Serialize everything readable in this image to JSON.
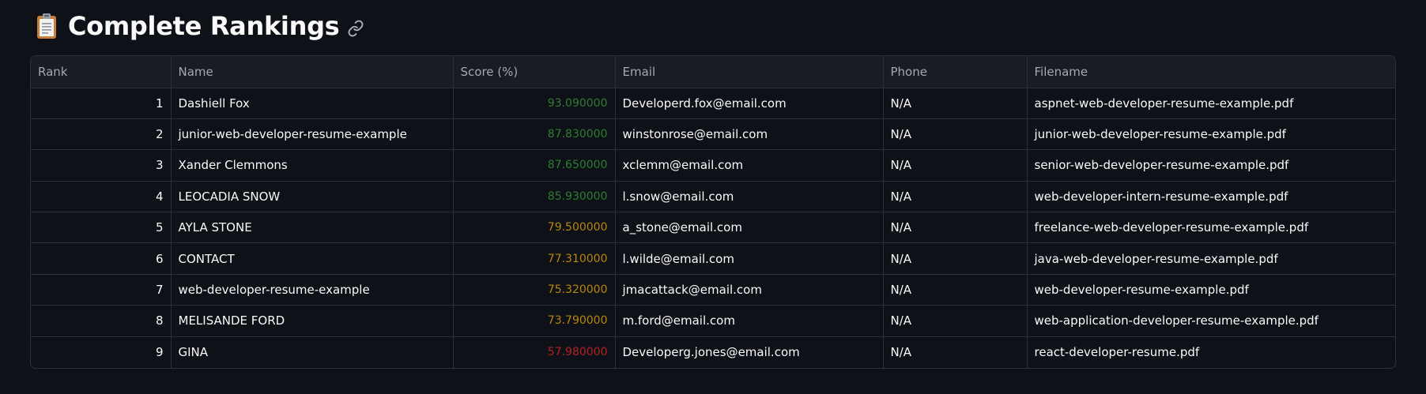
{
  "header": {
    "title": "Complete Rankings",
    "icon": "clipboard-icon",
    "link_icon": "link-icon"
  },
  "table": {
    "columns": [
      "Rank",
      "Name",
      "Score (%)",
      "Email",
      "Phone",
      "Filename"
    ],
    "rows": [
      {
        "rank": "1",
        "name": "Dashiell Fox",
        "score": "93.090000",
        "score_color": "#2e7d32",
        "email": "Developerd.fox@email.com",
        "phone": "N/A",
        "filename": "aspnet-web-developer-resume-example.pdf"
      },
      {
        "rank": "2",
        "name": "junior-web-developer-resume-example",
        "score": "87.830000",
        "score_color": "#2e7d32",
        "email": "winstonrose@email.com",
        "phone": "N/A",
        "filename": "junior-web-developer-resume-example.pdf"
      },
      {
        "rank": "3",
        "name": "Xander Clemmons",
        "score": "87.650000",
        "score_color": "#2e7d32",
        "email": "xclemm@email.com",
        "phone": "N/A",
        "filename": "senior-web-developer-resume-example.pdf"
      },
      {
        "rank": "4",
        "name": "LEOCADIA SNOW",
        "score": "85.930000",
        "score_color": "#2e7d32",
        "email": "l.snow@email.com",
        "phone": "N/A",
        "filename": "web-developer-intern-resume-example.pdf"
      },
      {
        "rank": "5",
        "name": "AYLA STONE",
        "score": "79.500000",
        "score_color": "#b8860b",
        "email": "a_stone@email.com",
        "phone": "N/A",
        "filename": "freelance-web-developer-resume-example.pdf"
      },
      {
        "rank": "6",
        "name": "CONTACT",
        "score": "77.310000",
        "score_color": "#b8860b",
        "email": "l.wilde@email.com",
        "phone": "N/A",
        "filename": "java-web-developer-resume-example.pdf"
      },
      {
        "rank": "7",
        "name": "web-developer-resume-example",
        "score": "75.320000",
        "score_color": "#b8860b",
        "email": "jmacattack@email.com",
        "phone": "N/A",
        "filename": "web-developer-resume-example.pdf"
      },
      {
        "rank": "8",
        "name": "MELISANDE FORD",
        "score": "73.790000",
        "score_color": "#b8860b",
        "email": "m.ford@email.com",
        "phone": "N/A",
        "filename": "web-application-developer-resume-example.pdf"
      },
      {
        "rank": "9",
        "name": "GINA",
        "score": "57.980000",
        "score_color": "#b22222",
        "email": "Developerg.jones@email.com",
        "phone": "N/A",
        "filename": "react-developer-resume.pdf"
      }
    ]
  },
  "colors": {
    "background": "#0e1117",
    "header_bg": "#1a1c24",
    "border": "#2b2f38",
    "score_high": "#2e7d32",
    "score_mid": "#b8860b",
    "score_low": "#b22222"
  }
}
